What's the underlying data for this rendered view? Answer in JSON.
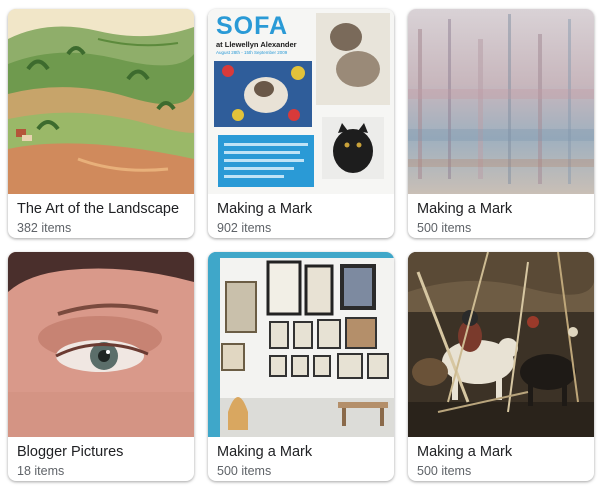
{
  "albums": [
    {
      "title": "The Art of the Landscape",
      "count": "382 items"
    },
    {
      "title": "Making a Mark",
      "count": "902 items"
    },
    {
      "title": "Making a Mark",
      "count": "500 items"
    },
    {
      "title": "Blogger Pictures",
      "count": "18 items"
    },
    {
      "title": "Making a Mark",
      "count": "500 items"
    },
    {
      "title": "Making a Mark",
      "count": "500 items"
    }
  ],
  "poster": {
    "heading": "SOFA",
    "subheading": "at Llewellyn Alexander",
    "dates": "August 28th - 15th September 2009"
  },
  "colors": {
    "title_text": "#202124",
    "count_text": "#5f6368",
    "poster_blue": "#2a9ad6"
  }
}
